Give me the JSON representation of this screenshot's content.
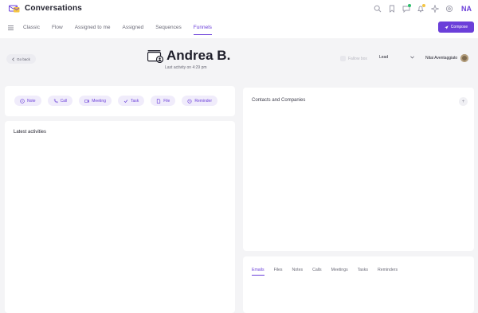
{
  "app": {
    "title": "Conversations",
    "user_initials": "NA",
    "accent_color": "#6b3fd9"
  },
  "top_icons": [
    "search-icon",
    "bookmark-icon",
    "chat-icon",
    "bell-icon",
    "sparkle-icon",
    "settings-icon"
  ],
  "nav": {
    "tabs": [
      {
        "label": "Classic",
        "active": false
      },
      {
        "label": "Flow",
        "active": false
      },
      {
        "label": "Assigned to me",
        "active": false
      },
      {
        "label": "Assigned",
        "active": false
      },
      {
        "label": "Sequences",
        "active": false
      },
      {
        "label": "Funnels",
        "active": true
      }
    ],
    "compose_label": "Compose"
  },
  "header": {
    "back_label": "Go back",
    "contact_name": "Andrea B.",
    "last_activity": "Last activity on 4:29 pm",
    "fallow_label": "Fallow box",
    "stage_value": "Lead",
    "owner_name": "Nitai Aventaggiato"
  },
  "actions": [
    {
      "label": "Note",
      "icon": "note-icon"
    },
    {
      "label": "Call",
      "icon": "phone-icon"
    },
    {
      "label": "Meeting",
      "icon": "meeting-icon"
    },
    {
      "label": "Task",
      "icon": "task-icon"
    },
    {
      "label": "File",
      "icon": "file-icon"
    },
    {
      "label": "Reminder",
      "icon": "reminder-icon"
    }
  ],
  "activities": {
    "title": "Latest activities"
  },
  "contacts": {
    "title": "Contacts and Companies",
    "add_label": "+"
  },
  "detail_tabs": [
    {
      "label": "Emails",
      "active": true
    },
    {
      "label": "Files",
      "active": false
    },
    {
      "label": "Notes",
      "active": false
    },
    {
      "label": "Calls",
      "active": false
    },
    {
      "label": "Meetings",
      "active": false
    },
    {
      "label": "Tasks",
      "active": false
    },
    {
      "label": "Reminders",
      "active": false
    }
  ]
}
